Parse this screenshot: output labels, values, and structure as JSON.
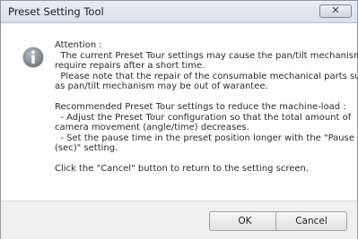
{
  "window": {
    "title": "Preset Setting Tool",
    "close_glyph": "✕"
  },
  "icon": {
    "name": "info-icon",
    "color": "#8a8f96"
  },
  "message": {
    "lines": [
      "Attention :",
      "  The current Preset Tour settings may cause the pan/tilt mechanism to",
      "require repairs after a short time.",
      "  Please note that the repair of the consumable mechanical parts such",
      "as pan/tilt mechanism may be out of warantee.",
      "",
      "Recommended Preset Tour settings to reduce the machine-load :",
      "  - Adjust the Preset Tour configuration so that the total amount of",
      "camera movement (angle/time) decreases.",
      "  - Set the pause time in the preset position longer with the \"Pause",
      "(sec)\" setting.",
      "",
      "Click the \"Cancel\" button to return to the setting screen."
    ]
  },
  "buttons": {
    "ok_label": "OK",
    "cancel_label": "Cancel"
  }
}
